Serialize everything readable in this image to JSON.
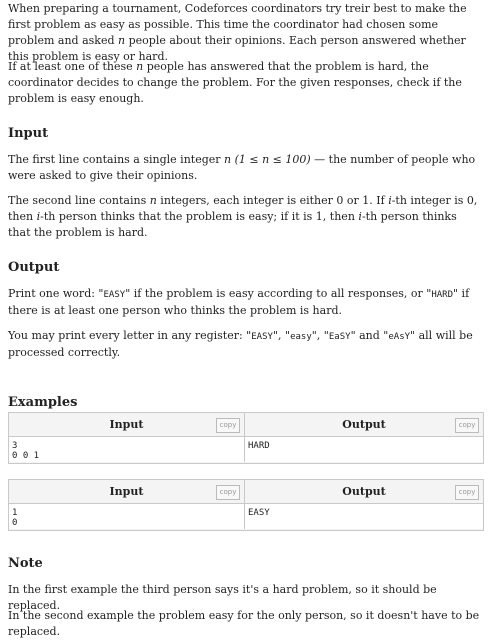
{
  "intro": {
    "p1_a": "When preparing a tournament, Codeforces coordinators try treir best to make the first problem as easy as possible. This time the coordinator had chosen some problem and asked ",
    "p1_var": "n",
    "p1_b": " people about their opinions. Each person answered whether this problem is easy or hard.",
    "p2_a": "If at least one of these ",
    "p2_var": "n",
    "p2_b": " people has answered that the problem is hard, the coordinator decides to change the problem. For the given responses, check if the problem is easy enough."
  },
  "input_section": {
    "heading": "Input",
    "p1_a": "The first line contains a single integer ",
    "p1_math": "n (1 ≤ n ≤ 100)",
    "p1_b": " — the number of people who were asked to give their opinions.",
    "p2_a": "The second line contains ",
    "p2_var": "n",
    "p2_b": " integers, each integer is either 0 or 1. If ",
    "p2_i1": "i",
    "p2_c": "-th integer is 0, then ",
    "p2_i2": "i",
    "p2_d": "-th person thinks that the problem is easy; if it is 1, then ",
    "p2_i3": "i",
    "p2_e": "-th person thinks that the problem is hard."
  },
  "output_section": {
    "heading": "Output",
    "p1_a": "Print one word: \"",
    "p1_easy": "EASY",
    "p1_b": "\" if the problem is easy according to all responses, or \"",
    "p1_hard": "HARD",
    "p1_c": "\" if there is at least one person who thinks the problem is hard.",
    "p2_a": "You may print every letter in any register: \"",
    "p2_v1": "EASY",
    "p2_b": "\", \"",
    "p2_v2": "easy",
    "p2_c": "\", \"",
    "p2_v3": "EaSY",
    "p2_d": "\" and \"",
    "p2_v4": "eAsY",
    "p2_e": "\" all will be processed correctly."
  },
  "examples": {
    "heading": "Examples",
    "input_label": "Input",
    "output_label": "Output",
    "copy_label": "copy",
    "ex1_input_line1": "3",
    "ex1_input_line2": "0 0 1",
    "ex1_output": "HARD",
    "ex2_input_line1": "1",
    "ex2_input_line2": "0",
    "ex2_output": "EASY"
  },
  "note": {
    "heading": "Note",
    "p1": "In the first example the third person says it's a hard problem, so it should be replaced.",
    "p2": "In the second example the problem easy for the only person, so it doesn't have to be replaced."
  }
}
